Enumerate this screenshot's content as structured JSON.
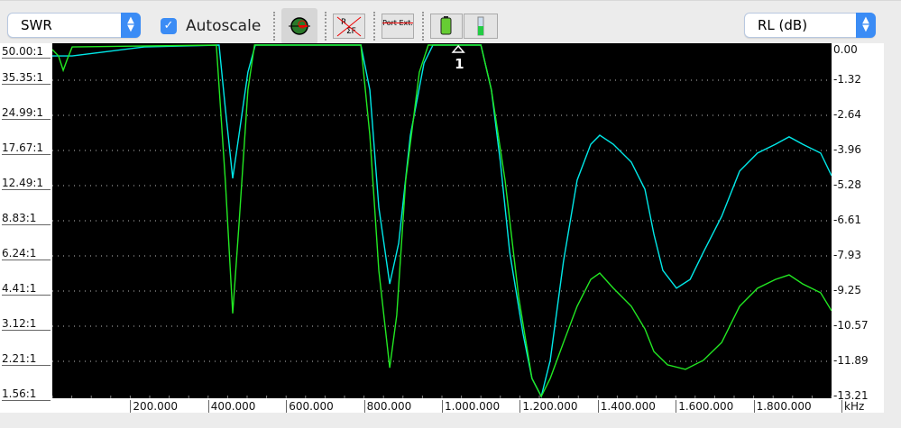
{
  "toolbar": {
    "left_select": "SWR",
    "autoscale_label": "Autoscale",
    "autoscale_checked": true,
    "right_select": "RL (dB)",
    "buttons": [
      {
        "name": "smith-chart-button",
        "icon": "smith-chart-icon"
      },
      {
        "name": "reference-off-button",
        "icon": "ref-crossed-icon"
      },
      {
        "name": "port-extension-button",
        "icon": "port-ext-crossed-icon",
        "label": "Port Ext."
      },
      {
        "name": "battery-button",
        "icon": "battery-icon"
      },
      {
        "name": "thermometer-button",
        "icon": "thermometer-icon"
      }
    ]
  },
  "chart_data": {
    "type": "line",
    "xlabel": "kHz",
    "xlim": [
      0,
      2000
    ],
    "x_ticks": [
      "200.000",
      "400.000",
      "600.000",
      "800.000",
      "1.000.000",
      "1.200.000",
      "1.400.000",
      "1.600.000",
      "1.800.000"
    ],
    "left_axis_ticks": [
      "50.00:1",
      "35.35:1",
      "24.99:1",
      "17.67:1",
      "12.49:1",
      "8.83:1",
      "6.24:1",
      "4.41:1",
      "3.12:1",
      "2.21:1",
      "1.56:1"
    ],
    "right_axis_ticks": [
      "0.00",
      "-1.32",
      "-2.64",
      "-3.96",
      "-5.28",
      "-6.61",
      "-7.93",
      "-9.25",
      "-10.57",
      "-11.89",
      "-13.21"
    ],
    "ylim_right": [
      -13.21,
      0
    ],
    "grid": true,
    "background": "#000000",
    "marker": {
      "label": "1",
      "x": 1042
    },
    "series": [
      {
        "color": "#00e8e8",
        "points": [
          [
            0,
            -0.41
          ],
          [
            51,
            -0.41
          ],
          [
            144,
            -0.24
          ],
          [
            236,
            -0.07
          ],
          [
            428,
            0
          ],
          [
            444,
            -2.37
          ],
          [
            463,
            -5.01
          ],
          [
            479,
            -3.39
          ],
          [
            502,
            -1.02
          ],
          [
            521,
            0
          ],
          [
            792,
            0
          ],
          [
            815,
            -1.69
          ],
          [
            838,
            -6.1
          ],
          [
            866,
            -8.98
          ],
          [
            889,
            -7.45
          ],
          [
            919,
            -3.39
          ],
          [
            954,
            -0.68
          ],
          [
            977,
            0
          ],
          [
            1100,
            0
          ],
          [
            1127,
            -1.69
          ],
          [
            1150,
            -4.4
          ],
          [
            1174,
            -7.79
          ],
          [
            1208,
            -10.84
          ],
          [
            1231,
            -12.53
          ],
          [
            1255,
            -13.21
          ],
          [
            1278,
            -11.85
          ],
          [
            1312,
            -8.13
          ],
          [
            1347,
            -5.08
          ],
          [
            1382,
            -3.73
          ],
          [
            1405,
            -3.39
          ],
          [
            1440,
            -3.73
          ],
          [
            1486,
            -4.4
          ],
          [
            1521,
            -5.42
          ],
          [
            1544,
            -7.11
          ],
          [
            1567,
            -8.47
          ],
          [
            1602,
            -9.14
          ],
          [
            1637,
            -8.81
          ],
          [
            1671,
            -7.79
          ],
          [
            1718,
            -6.44
          ],
          [
            1764,
            -4.74
          ],
          [
            1810,
            -4.06
          ],
          [
            1856,
            -3.73
          ],
          [
            1891,
            -3.45
          ],
          [
            1926,
            -3.73
          ],
          [
            1972,
            -4.06
          ],
          [
            2000,
            -4.91
          ]
        ]
      },
      {
        "color": "#22e822",
        "points": [
          [
            0,
            -0.17
          ],
          [
            16,
            -0.41
          ],
          [
            28,
            -0.95
          ],
          [
            39,
            -0.51
          ],
          [
            51,
            -0.07
          ],
          [
            421,
            0
          ],
          [
            444,
            -5.08
          ],
          [
            463,
            -10.09
          ],
          [
            479,
            -6.77
          ],
          [
            502,
            -1.69
          ],
          [
            519,
            0
          ],
          [
            792,
            0
          ],
          [
            815,
            -3.39
          ],
          [
            838,
            -8.47
          ],
          [
            866,
            -12.13
          ],
          [
            884,
            -10.16
          ],
          [
            907,
            -5.08
          ],
          [
            942,
            -1.02
          ],
          [
            965,
            0
          ],
          [
            1100,
            0
          ],
          [
            1127,
            -1.69
          ],
          [
            1162,
            -5.08
          ],
          [
            1197,
            -9.48
          ],
          [
            1231,
            -12.53
          ],
          [
            1255,
            -13.21
          ],
          [
            1278,
            -12.53
          ],
          [
            1312,
            -11.18
          ],
          [
            1347,
            -9.82
          ],
          [
            1382,
            -8.81
          ],
          [
            1405,
            -8.57
          ],
          [
            1440,
            -9.14
          ],
          [
            1486,
            -9.82
          ],
          [
            1521,
            -10.67
          ],
          [
            1544,
            -11.52
          ],
          [
            1579,
            -12.02
          ],
          [
            1625,
            -12.19
          ],
          [
            1671,
            -11.85
          ],
          [
            1718,
            -11.18
          ],
          [
            1764,
            -9.82
          ],
          [
            1810,
            -9.14
          ],
          [
            1856,
            -8.81
          ],
          [
            1891,
            -8.64
          ],
          [
            1926,
            -8.98
          ],
          [
            1972,
            -9.31
          ],
          [
            2000,
            -9.99
          ]
        ]
      }
    ]
  }
}
